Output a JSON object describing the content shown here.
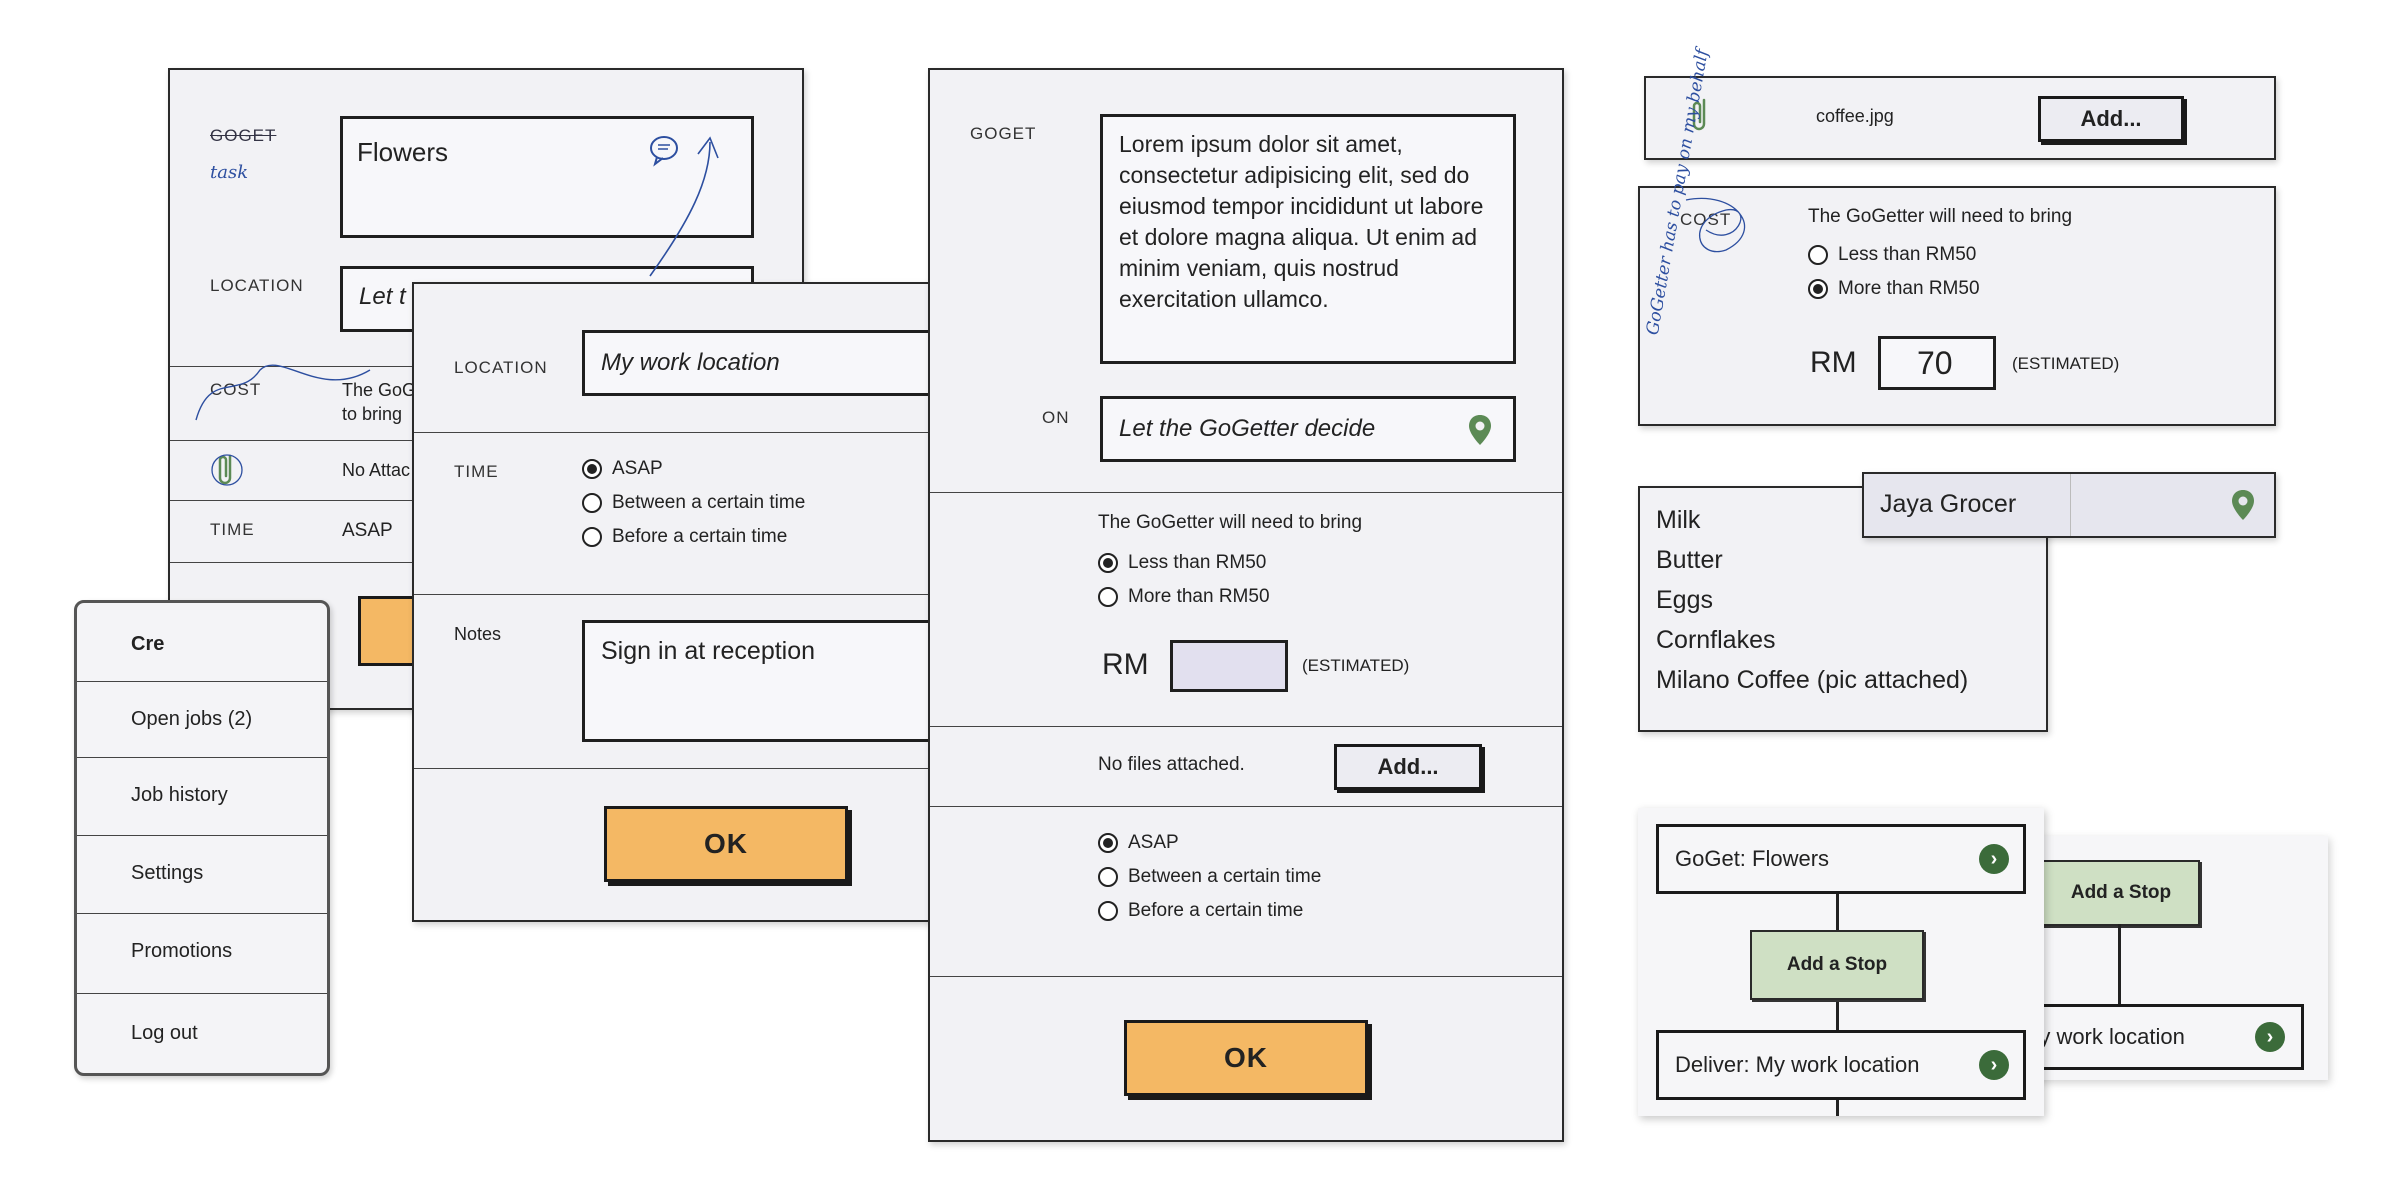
{
  "labels": {
    "goget": "GOGET",
    "task": "task",
    "location": "LOCATION",
    "cost": "COST",
    "time": "TIME",
    "notes": "Notes",
    "estimated": "(ESTIMATED)",
    "rm": "RM"
  },
  "card1": {
    "goget_value": "Flowers",
    "location_value": "Let t",
    "cost_text_line1": "The GoG",
    "cost_text_line2": "to bring",
    "attach_text": "No Attac",
    "time_value": "ASAP"
  },
  "menu": {
    "items": [
      "Cre",
      "Open jobs (2)",
      "Job history",
      "Settings",
      "Promotions",
      "Log out"
    ]
  },
  "dialog": {
    "location_value": "My work location",
    "time_options": [
      "ASAP",
      "Between a certain time",
      "Before a certain time"
    ],
    "time_selected": 0,
    "notes_value": "Sign in at reception",
    "ok_label": "OK"
  },
  "card2": {
    "goget_text": "Lorem ipsum dolor sit amet, consectetur adipisicing elit, sed do eiusmod tempor incididunt ut labore et dolore magna aliqua. Ut enim ad minim veniam, quis nostrud exercitation ullamco.",
    "location_label_partial": "ON",
    "location_value": "Let the GoGetter decide",
    "cost_text": "The GoGetter will need to bring",
    "cost_options": [
      "Less than RM50",
      "More than RM50"
    ],
    "cost_selected": 0,
    "rm_value": "",
    "files_text": "No files attached.",
    "add_label": "Add...",
    "time_options": [
      "ASAP",
      "Between a certain time",
      "Before a certain time"
    ],
    "time_selected": 0,
    "ok_label": "OK"
  },
  "attach_strip": {
    "filename": "coffee.jpg",
    "add_label": "Add..."
  },
  "cost_panel": {
    "label": "COST",
    "text": "The GoGetter will need to bring",
    "options": [
      "Less than RM50",
      "More than RM50"
    ],
    "selected": 1,
    "rm_value": "70",
    "note_handwritten": "GoGetter has to pay on my behalf"
  },
  "grocery": {
    "store": "Jaya Grocer",
    "items": [
      "Milk",
      "Butter",
      "Eggs",
      "Cornflakes",
      "Milano Coffee (pic attached)"
    ]
  },
  "stops": {
    "first": "GoGet: Flowers",
    "add_stop_label": "Add a Stop",
    "deliver": "Deliver: My work location",
    "second_add_stop_label": "Add a Stop",
    "second_location": "My work location"
  },
  "colors": {
    "ok_orange": "#f4b864",
    "pin_green": "#5c8a55",
    "stop_green": "#cfe0c4",
    "arrow_green": "#3b6b3a",
    "paper": "#f2f2f5",
    "pen_blue": "#2d4fa0"
  },
  "icons": {
    "location": "map-pin-icon",
    "attach": "paperclip-icon",
    "chat": "chat-bubble-icon",
    "next": "chevron-right-circle-icon"
  }
}
